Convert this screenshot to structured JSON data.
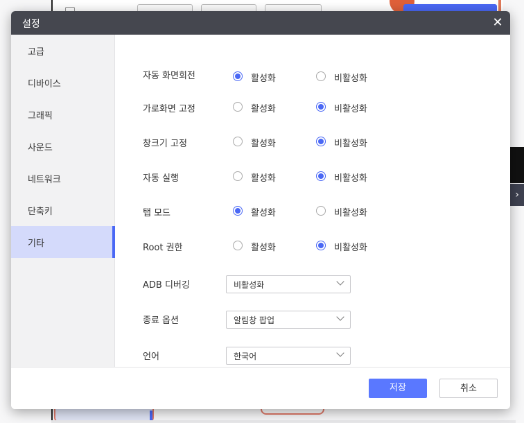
{
  "dialog": {
    "title": "설정",
    "close_icon": "close-icon"
  },
  "sidebar": {
    "items": [
      {
        "label": "고급"
      },
      {
        "label": "디바이스"
      },
      {
        "label": "그래픽"
      },
      {
        "label": "사운드"
      },
      {
        "label": "네트워크"
      },
      {
        "label": "단축키"
      },
      {
        "label": "기타",
        "active": true
      }
    ]
  },
  "settings": {
    "radio_rows": [
      {
        "label": "자동 화면회전",
        "options": [
          "활성화",
          "비활성화"
        ],
        "selected": "활성화"
      },
      {
        "label": "가로화면 고정",
        "options": [
          "활성화",
          "비활성화"
        ],
        "selected": "비활성화"
      },
      {
        "label": "창크기 고정",
        "options": [
          "활성화",
          "비활성화"
        ],
        "selected": "비활성화"
      },
      {
        "label": "자동 실행",
        "options": [
          "활성화",
          "비활성화"
        ],
        "selected": "비활성화"
      },
      {
        "label": "탭 모드",
        "options": [
          "활성화",
          "비활성화"
        ],
        "selected": "활성화"
      },
      {
        "label": "Root 권한",
        "options": [
          "활성화",
          "비활성화"
        ],
        "selected": "비활성화"
      }
    ],
    "select_rows": [
      {
        "label": "ADB 디버깅",
        "value": "비활성화"
      },
      {
        "label": "종료 옵션",
        "value": "알림창 팝업"
      },
      {
        "label": "언어",
        "value": "한국어"
      }
    ]
  },
  "footer": {
    "save_label": "저장",
    "cancel_label": "취소"
  },
  "colors": {
    "accent": "#4a68f5",
    "titlebar": "#45474f",
    "sidebar_active": "#d4dafb"
  }
}
